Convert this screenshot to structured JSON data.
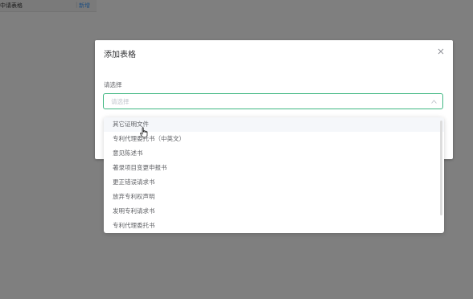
{
  "background": {
    "toolbar_label": "中请表格",
    "separator": "|",
    "toolbar_action": "新增"
  },
  "dialog": {
    "title": "添加表格",
    "close_icon": "close-icon",
    "form_label": "请选择",
    "select": {
      "value": "",
      "placeholder": "请选择",
      "arrow_icon": "chevron-up-icon"
    },
    "options": [
      "其它证明文件",
      "专利代理委托书（中英文）",
      "意见陈述书",
      "著录项目变更申报书",
      "更正错误请求书",
      "放弃专利权声明",
      "发明专利请求书",
      "专利代理委托书"
    ],
    "hovered_option_index": 0
  },
  "colors": {
    "accent": "#41b883",
    "overlay": "rgba(0,0,0,0.5)",
    "link": "#409eff",
    "text": "#606266"
  }
}
